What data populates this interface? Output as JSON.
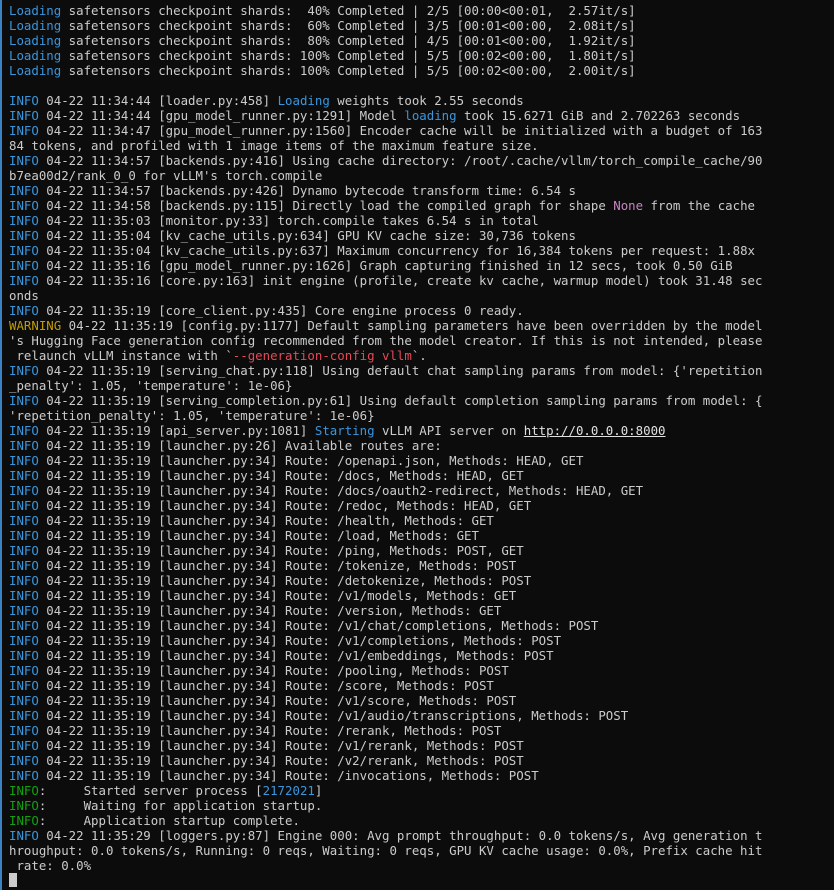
{
  "colors": {
    "background": "#0c0c0c",
    "text": "#cccccc",
    "info": "#3a96dd",
    "warning": "#c19c00",
    "green": "#13a10e",
    "magenta": "#c586c0",
    "red": "#e74856",
    "window_border": "#3b82c4"
  },
  "lines": [
    {
      "segs": [
        {
          "t": "Loading",
          "c": "info"
        },
        {
          "t": " safetensors checkpoint shards:  40% Completed | 2/5 [00:00<00:01,  2.57it/s]"
        }
      ]
    },
    {
      "segs": [
        {
          "t": "Loading",
          "c": "info"
        },
        {
          "t": " safetensors checkpoint shards:  60% Completed | 3/5 [00:01<00:00,  2.08it/s]"
        }
      ]
    },
    {
      "segs": [
        {
          "t": "Loading",
          "c": "info"
        },
        {
          "t": " safetensors checkpoint shards:  80% Completed | 4/5 [00:01<00:00,  1.92it/s]"
        }
      ]
    },
    {
      "segs": [
        {
          "t": "Loading",
          "c": "info"
        },
        {
          "t": " safetensors checkpoint shards: 100% Completed | 5/5 [00:02<00:00,  1.80it/s]"
        }
      ]
    },
    {
      "segs": [
        {
          "t": "Loading",
          "c": "info"
        },
        {
          "t": " safetensors checkpoint shards: 100% Completed | 5/5 [00:02<00:00,  2.00it/s]"
        }
      ]
    },
    {
      "segs": []
    },
    {
      "segs": [
        {
          "t": "INFO",
          "c": "info"
        },
        {
          "t": " 04-22 11:34:44 [loader.py:458] "
        },
        {
          "t": "Loading",
          "c": "info"
        },
        {
          "t": " weights took 2.55 seconds"
        }
      ]
    },
    {
      "segs": [
        {
          "t": "INFO",
          "c": "info"
        },
        {
          "t": " 04-22 11:34:44 [gpu_model_runner.py:1291] Model "
        },
        {
          "t": "loading",
          "c": "info"
        },
        {
          "t": " took 15.6271 GiB and 2.702263 seconds"
        }
      ]
    },
    {
      "segs": [
        {
          "t": "INFO",
          "c": "info"
        },
        {
          "t": " 04-22 11:34:47 [gpu_model_runner.py:1560] Encoder cache will be initialized with a budget of 163"
        }
      ]
    },
    {
      "segs": [
        {
          "t": "84 tokens, and profiled with 1 image items of the maximum feature size."
        }
      ]
    },
    {
      "segs": [
        {
          "t": "INFO",
          "c": "info"
        },
        {
          "t": " 04-22 11:34:57 [backends.py:416] Using cache directory: /root/.cache/vllm/torch_compile_cache/90"
        }
      ]
    },
    {
      "segs": [
        {
          "t": "b7ea00d2/rank_0_0 for vLLM's torch.compile"
        }
      ]
    },
    {
      "segs": [
        {
          "t": "INFO",
          "c": "info"
        },
        {
          "t": " 04-22 11:34:57 [backends.py:426] Dynamo bytecode transform time: 6.54 s"
        }
      ]
    },
    {
      "segs": [
        {
          "t": "INFO",
          "c": "info"
        },
        {
          "t": " 04-22 11:34:58 [backends.py:115] Directly load the compiled graph for shape "
        },
        {
          "t": "None",
          "c": "magenta"
        },
        {
          "t": " from the cache"
        }
      ]
    },
    {
      "segs": [
        {
          "t": "INFO",
          "c": "info"
        },
        {
          "t": " 04-22 11:35:03 [monitor.py:33] torch.compile takes 6.54 s in total"
        }
      ]
    },
    {
      "segs": [
        {
          "t": "INFO",
          "c": "info"
        },
        {
          "t": " 04-22 11:35:04 [kv_cache_utils.py:634] GPU KV cache size: 30,736 tokens"
        }
      ]
    },
    {
      "segs": [
        {
          "t": "INFO",
          "c": "info"
        },
        {
          "t": " 04-22 11:35:04 [kv_cache_utils.py:637] Maximum concurrency for 16,384 tokens per request: 1.88x"
        }
      ]
    },
    {
      "segs": [
        {
          "t": "INFO",
          "c": "info"
        },
        {
          "t": " 04-22 11:35:16 [gpu_model_runner.py:1626] Graph capturing finished in 12 secs, took 0.50 GiB"
        }
      ]
    },
    {
      "segs": [
        {
          "t": "INFO",
          "c": "info"
        },
        {
          "t": " 04-22 11:35:16 [core.py:163] init engine (profile, create kv cache, warmup model) took 31.48 sec"
        }
      ]
    },
    {
      "segs": [
        {
          "t": "onds"
        }
      ]
    },
    {
      "segs": [
        {
          "t": "INFO",
          "c": "info"
        },
        {
          "t": " 04-22 11:35:19 [core_client.py:435] Core engine process 0 ready."
        }
      ]
    },
    {
      "segs": [
        {
          "t": "WARNING",
          "c": "warn"
        },
        {
          "t": " 04-22 11:35:19 [config.py:1177] Default sampling parameters have been overridden by the model"
        }
      ]
    },
    {
      "segs": [
        {
          "t": "'s Hugging Face generation config recommended from the model creator. If this is not intended, please"
        }
      ]
    },
    {
      "segs": [
        {
          "t": " relaunch vLLM instance with `"
        },
        {
          "t": "--generation-config vllm",
          "c": "red"
        },
        {
          "t": "`."
        }
      ]
    },
    {
      "segs": [
        {
          "t": "INFO",
          "c": "info"
        },
        {
          "t": " 04-22 11:35:19 [serving_chat.py:118] Using default chat sampling params from model: {'repetition"
        }
      ]
    },
    {
      "segs": [
        {
          "t": "_penalty': 1.05, 'temperature': 1e-06}"
        }
      ]
    },
    {
      "segs": [
        {
          "t": "INFO",
          "c": "info"
        },
        {
          "t": " 04-22 11:35:19 [serving_completion.py:61] Using default completion sampling params from model: {"
        }
      ]
    },
    {
      "segs": [
        {
          "t": "'repetition_penalty': 1.05, 'temperature': 1e-06}"
        }
      ]
    },
    {
      "segs": [
        {
          "t": "INFO",
          "c": "info"
        },
        {
          "t": " 04-22 11:35:19 [api_server.py:1081] "
        },
        {
          "t": "Starting",
          "c": "info"
        },
        {
          "t": " vLLM API server on "
        },
        {
          "t": "http://0.0.0.0:8000",
          "c": "url"
        }
      ]
    },
    {
      "segs": [
        {
          "t": "INFO",
          "c": "info"
        },
        {
          "t": " 04-22 11:35:19 [launcher.py:26] Available routes are:"
        }
      ]
    },
    {
      "segs": [
        {
          "t": "INFO",
          "c": "info"
        },
        {
          "t": " 04-22 11:35:19 [launcher.py:34] Route: /openapi.json, Methods: HEAD, GET"
        }
      ]
    },
    {
      "segs": [
        {
          "t": "INFO",
          "c": "info"
        },
        {
          "t": " 04-22 11:35:19 [launcher.py:34] Route: /docs, Methods: HEAD, GET"
        }
      ]
    },
    {
      "segs": [
        {
          "t": "INFO",
          "c": "info"
        },
        {
          "t": " 04-22 11:35:19 [launcher.py:34] Route: /docs/oauth2-redirect, Methods: HEAD, GET"
        }
      ]
    },
    {
      "segs": [
        {
          "t": "INFO",
          "c": "info"
        },
        {
          "t": " 04-22 11:35:19 [launcher.py:34] Route: /redoc, Methods: HEAD, GET"
        }
      ]
    },
    {
      "segs": [
        {
          "t": "INFO",
          "c": "info"
        },
        {
          "t": " 04-22 11:35:19 [launcher.py:34] Route: /health, Methods: GET"
        }
      ]
    },
    {
      "segs": [
        {
          "t": "INFO",
          "c": "info"
        },
        {
          "t": " 04-22 11:35:19 [launcher.py:34] Route: /load, Methods: GET"
        }
      ]
    },
    {
      "segs": [
        {
          "t": "INFO",
          "c": "info"
        },
        {
          "t": " 04-22 11:35:19 [launcher.py:34] Route: /ping, Methods: POST, GET"
        }
      ]
    },
    {
      "segs": [
        {
          "t": "INFO",
          "c": "info"
        },
        {
          "t": " 04-22 11:35:19 [launcher.py:34] Route: /tokenize, Methods: POST"
        }
      ]
    },
    {
      "segs": [
        {
          "t": "INFO",
          "c": "info"
        },
        {
          "t": " 04-22 11:35:19 [launcher.py:34] Route: /detokenize, Methods: POST"
        }
      ]
    },
    {
      "segs": [
        {
          "t": "INFO",
          "c": "info"
        },
        {
          "t": " 04-22 11:35:19 [launcher.py:34] Route: /v1/models, Methods: GET"
        }
      ]
    },
    {
      "segs": [
        {
          "t": "INFO",
          "c": "info"
        },
        {
          "t": " 04-22 11:35:19 [launcher.py:34] Route: /version, Methods: GET"
        }
      ]
    },
    {
      "segs": [
        {
          "t": "INFO",
          "c": "info"
        },
        {
          "t": " 04-22 11:35:19 [launcher.py:34] Route: /v1/chat/completions, Methods: POST"
        }
      ]
    },
    {
      "segs": [
        {
          "t": "INFO",
          "c": "info"
        },
        {
          "t": " 04-22 11:35:19 [launcher.py:34] Route: /v1/completions, Methods: POST"
        }
      ]
    },
    {
      "segs": [
        {
          "t": "INFO",
          "c": "info"
        },
        {
          "t": " 04-22 11:35:19 [launcher.py:34] Route: /v1/embeddings, Methods: POST"
        }
      ]
    },
    {
      "segs": [
        {
          "t": "INFO",
          "c": "info"
        },
        {
          "t": " 04-22 11:35:19 [launcher.py:34] Route: /pooling, Methods: POST"
        }
      ]
    },
    {
      "segs": [
        {
          "t": "INFO",
          "c": "info"
        },
        {
          "t": " 04-22 11:35:19 [launcher.py:34] Route: /score, Methods: POST"
        }
      ]
    },
    {
      "segs": [
        {
          "t": "INFO",
          "c": "info"
        },
        {
          "t": " 04-22 11:35:19 [launcher.py:34] Route: /v1/score, Methods: POST"
        }
      ]
    },
    {
      "segs": [
        {
          "t": "INFO",
          "c": "info"
        },
        {
          "t": " 04-22 11:35:19 [launcher.py:34] Route: /v1/audio/transcriptions, Methods: POST"
        }
      ]
    },
    {
      "segs": [
        {
          "t": "INFO",
          "c": "info"
        },
        {
          "t": " 04-22 11:35:19 [launcher.py:34] Route: /rerank, Methods: POST"
        }
      ]
    },
    {
      "segs": [
        {
          "t": "INFO",
          "c": "info"
        },
        {
          "t": " 04-22 11:35:19 [launcher.py:34] Route: /v1/rerank, Methods: POST"
        }
      ]
    },
    {
      "segs": [
        {
          "t": "INFO",
          "c": "info"
        },
        {
          "t": " 04-22 11:35:19 [launcher.py:34] Route: /v2/rerank, Methods: POST"
        }
      ]
    },
    {
      "segs": [
        {
          "t": "INFO",
          "c": "info"
        },
        {
          "t": " 04-22 11:35:19 [launcher.py:34] Route: /invocations, Methods: POST"
        }
      ]
    },
    {
      "segs": [
        {
          "t": "INFO",
          "c": "green"
        },
        {
          "t": ":     Started server process ["
        },
        {
          "t": "2172021",
          "c": "blue"
        },
        {
          "t": "]"
        }
      ]
    },
    {
      "segs": [
        {
          "t": "INFO",
          "c": "green"
        },
        {
          "t": ":     Waiting for application startup."
        }
      ]
    },
    {
      "segs": [
        {
          "t": "INFO",
          "c": "green"
        },
        {
          "t": ":     Application startup complete."
        }
      ]
    },
    {
      "segs": [
        {
          "t": "INFO",
          "c": "info"
        },
        {
          "t": " 04-22 11:35:29 [loggers.py:87] Engine 000: Avg prompt throughput: 0.0 tokens/s, Avg generation t"
        }
      ]
    },
    {
      "segs": [
        {
          "t": "hroughput: 0.0 tokens/s, Running: 0 reqs, Waiting: 0 reqs, GPU KV cache usage: 0.0%, Prefix cache hit"
        }
      ]
    },
    {
      "segs": [
        {
          "t": " rate: 0.0%"
        }
      ]
    }
  ]
}
